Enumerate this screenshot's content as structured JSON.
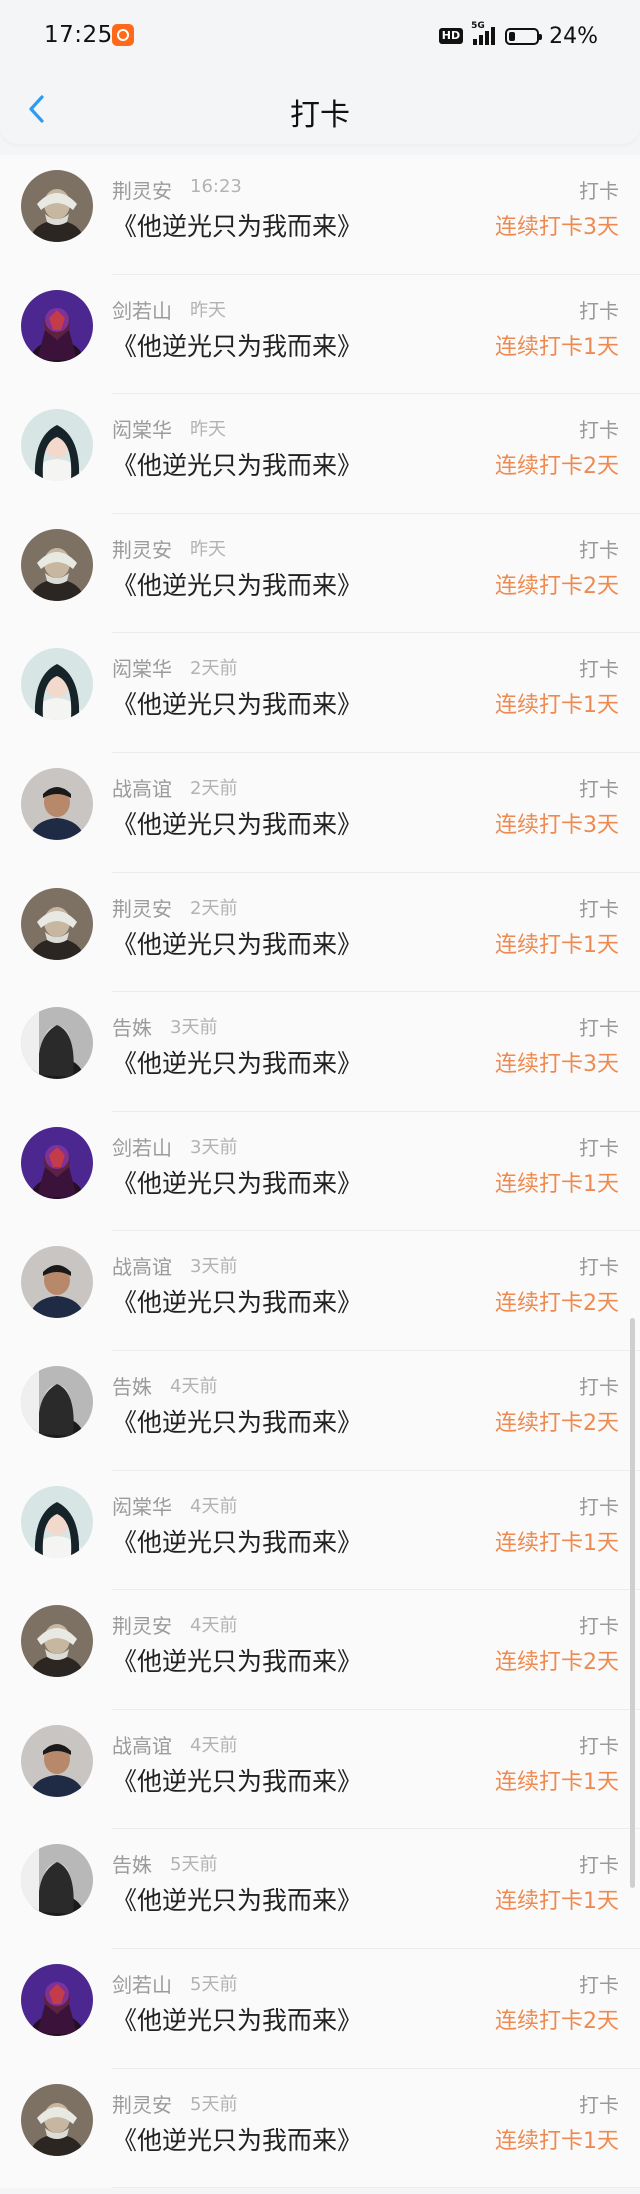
{
  "status_bar": {
    "time": "17:25",
    "hd": "HD",
    "network": "5G",
    "battery": "24%",
    "battery_level": 0.24
  },
  "header": {
    "title": "打卡"
  },
  "icons": {
    "back": "back-chevron-icon",
    "app": "notification-app-icon"
  },
  "colors": {
    "streak": "#ee8a4f",
    "back": "#2d9cf0",
    "secondary_text": "#9b9b9b"
  },
  "items": [
    {
      "name": "荆灵安",
      "time": "16:23",
      "book": "《他逆光只为我而来》",
      "action": "打卡",
      "streak": "连续打卡3天"
    },
    {
      "name": "剑若山",
      "time": "昨天",
      "book": "《他逆光只为我而来》",
      "action": "打卡",
      "streak": "连续打卡1天"
    },
    {
      "name": "闳棠华",
      "time": "昨天",
      "book": "《他逆光只为我而来》",
      "action": "打卡",
      "streak": "连续打卡2天"
    },
    {
      "name": "荆灵安",
      "time": "昨天",
      "book": "《他逆光只为我而来》",
      "action": "打卡",
      "streak": "连续打卡2天"
    },
    {
      "name": "闳棠华",
      "time": "2天前",
      "book": "《他逆光只为我而来》",
      "action": "打卡",
      "streak": "连续打卡1天"
    },
    {
      "name": "战高谊",
      "time": "2天前",
      "book": "《他逆光只为我而来》",
      "action": "打卡",
      "streak": "连续打卡3天"
    },
    {
      "name": "荆灵安",
      "time": "2天前",
      "book": "《他逆光只为我而来》",
      "action": "打卡",
      "streak": "连续打卡1天"
    },
    {
      "name": "告姝",
      "time": "3天前",
      "book": "《他逆光只为我而来》",
      "action": "打卡",
      "streak": "连续打卡3天"
    },
    {
      "name": "剑若山",
      "time": "3天前",
      "book": "《他逆光只为我而来》",
      "action": "打卡",
      "streak": "连续打卡1天"
    },
    {
      "name": "战高谊",
      "time": "3天前",
      "book": "《他逆光只为我而来》",
      "action": "打卡",
      "streak": "连续打卡2天"
    },
    {
      "name": "告姝",
      "time": "4天前",
      "book": "《他逆光只为我而来》",
      "action": "打卡",
      "streak": "连续打卡2天"
    },
    {
      "name": "闳棠华",
      "time": "4天前",
      "book": "《他逆光只为我而来》",
      "action": "打卡",
      "streak": "连续打卡1天"
    },
    {
      "name": "荆灵安",
      "time": "4天前",
      "book": "《他逆光只为我而来》",
      "action": "打卡",
      "streak": "连续打卡2天"
    },
    {
      "name": "战高谊",
      "time": "4天前",
      "book": "《他逆光只为我而来》",
      "action": "打卡",
      "streak": "连续打卡1天"
    },
    {
      "name": "告姝",
      "time": "5天前",
      "book": "《他逆光只为我而来》",
      "action": "打卡",
      "streak": "连续打卡1天"
    },
    {
      "name": "剑若山",
      "time": "5天前",
      "book": "《他逆光只为我而来》",
      "action": "打卡",
      "streak": "连续打卡2天"
    },
    {
      "name": "荆灵安",
      "time": "5天前",
      "book": "《他逆光只为我而来》",
      "action": "打卡",
      "streak": "连续打卡1天"
    }
  ]
}
